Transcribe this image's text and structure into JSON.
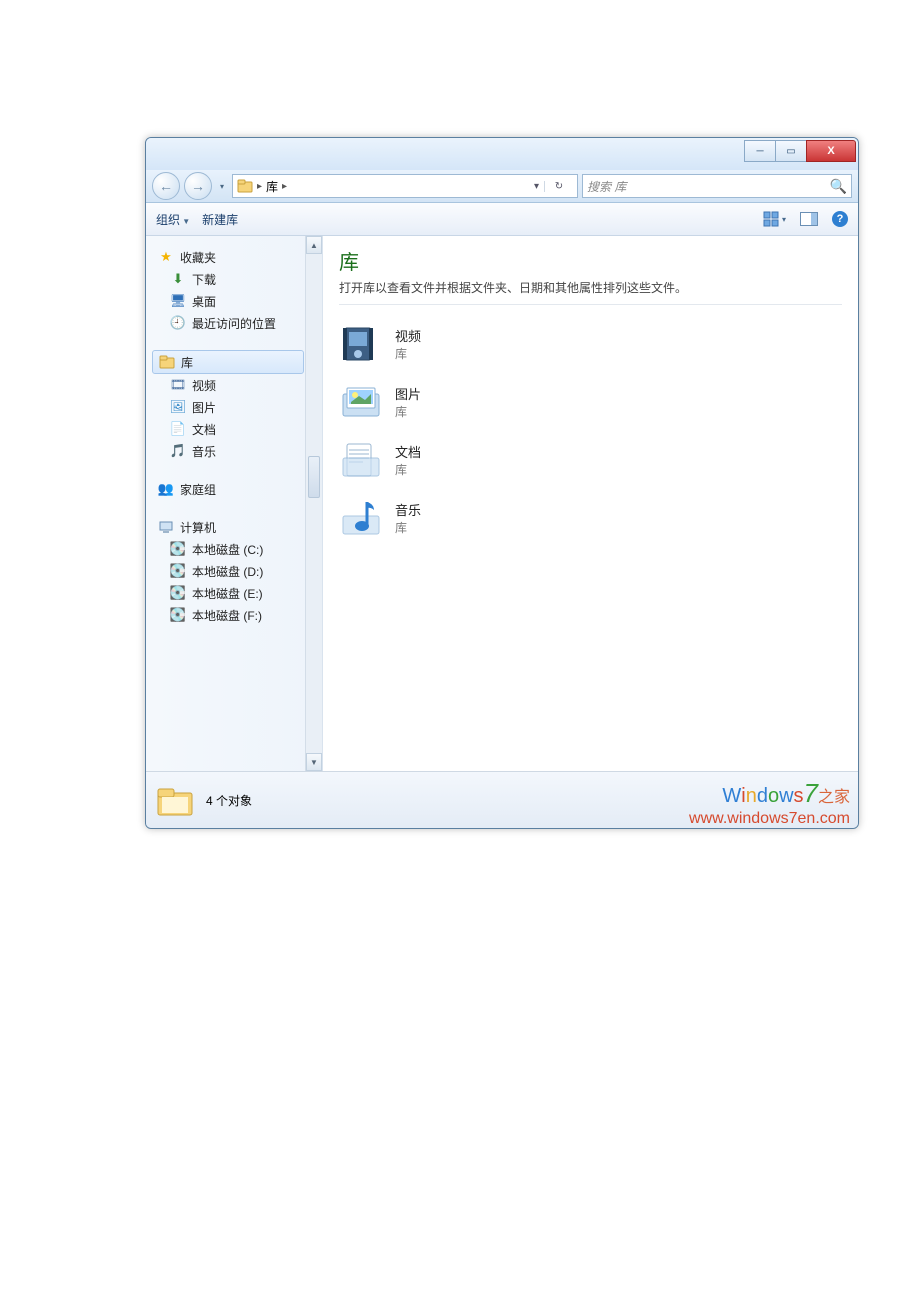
{
  "window_controls": {
    "min": "─",
    "max": "▭",
    "close": "X"
  },
  "nav": {
    "back": "←",
    "forward": "→",
    "history_dd": "▾",
    "crumb_root": "库",
    "crumb_sep": "▸",
    "addr_dd": "▾",
    "refresh": "↻"
  },
  "search": {
    "placeholder": "搜索 库",
    "icon": "🔍"
  },
  "toolbar": {
    "organize": "组织",
    "new_library": "新建库",
    "view_dd": "▾",
    "preview_pane": "▯",
    "help": "?"
  },
  "sidebar": {
    "favorites": {
      "label": "收藏夹",
      "items": [
        {
          "icon": "⬇",
          "label": "下载"
        },
        {
          "icon": "🖥",
          "label": "桌面"
        },
        {
          "icon": "🕘",
          "label": "最近访问的位置"
        }
      ]
    },
    "libraries": {
      "label": "库",
      "items": [
        {
          "icon": "🎞",
          "label": "视频"
        },
        {
          "icon": "🖼",
          "label": "图片"
        },
        {
          "icon": "📄",
          "label": "文档"
        },
        {
          "icon": "🎵",
          "label": "音乐"
        }
      ]
    },
    "homegroup": {
      "icon": "👥",
      "label": "家庭组"
    },
    "computer": {
      "label": "计算机",
      "items": [
        {
          "icon": "💽",
          "label": "本地磁盘 (C:)"
        },
        {
          "icon": "💽",
          "label": "本地磁盘 (D:)"
        },
        {
          "icon": "💽",
          "label": "本地磁盘 (E:)"
        },
        {
          "icon": "💽",
          "label": "本地磁盘 (F:)"
        }
      ]
    }
  },
  "content": {
    "title": "库",
    "subtitle": "打开库以查看文件并根据文件夹、日期和其他属性排列这些文件。",
    "kind_label": "库",
    "items": [
      {
        "name": "视频"
      },
      {
        "name": "图片"
      },
      {
        "name": "文档"
      },
      {
        "name": "音乐"
      }
    ]
  },
  "status": {
    "count": "4 个对象"
  },
  "watermark": {
    "line1_prefix_chars": [
      "W",
      "i",
      "n",
      "d",
      "o",
      "w",
      "s"
    ],
    "seven": "7",
    "zh": "之家",
    "line2": "www.windows7en.com"
  }
}
